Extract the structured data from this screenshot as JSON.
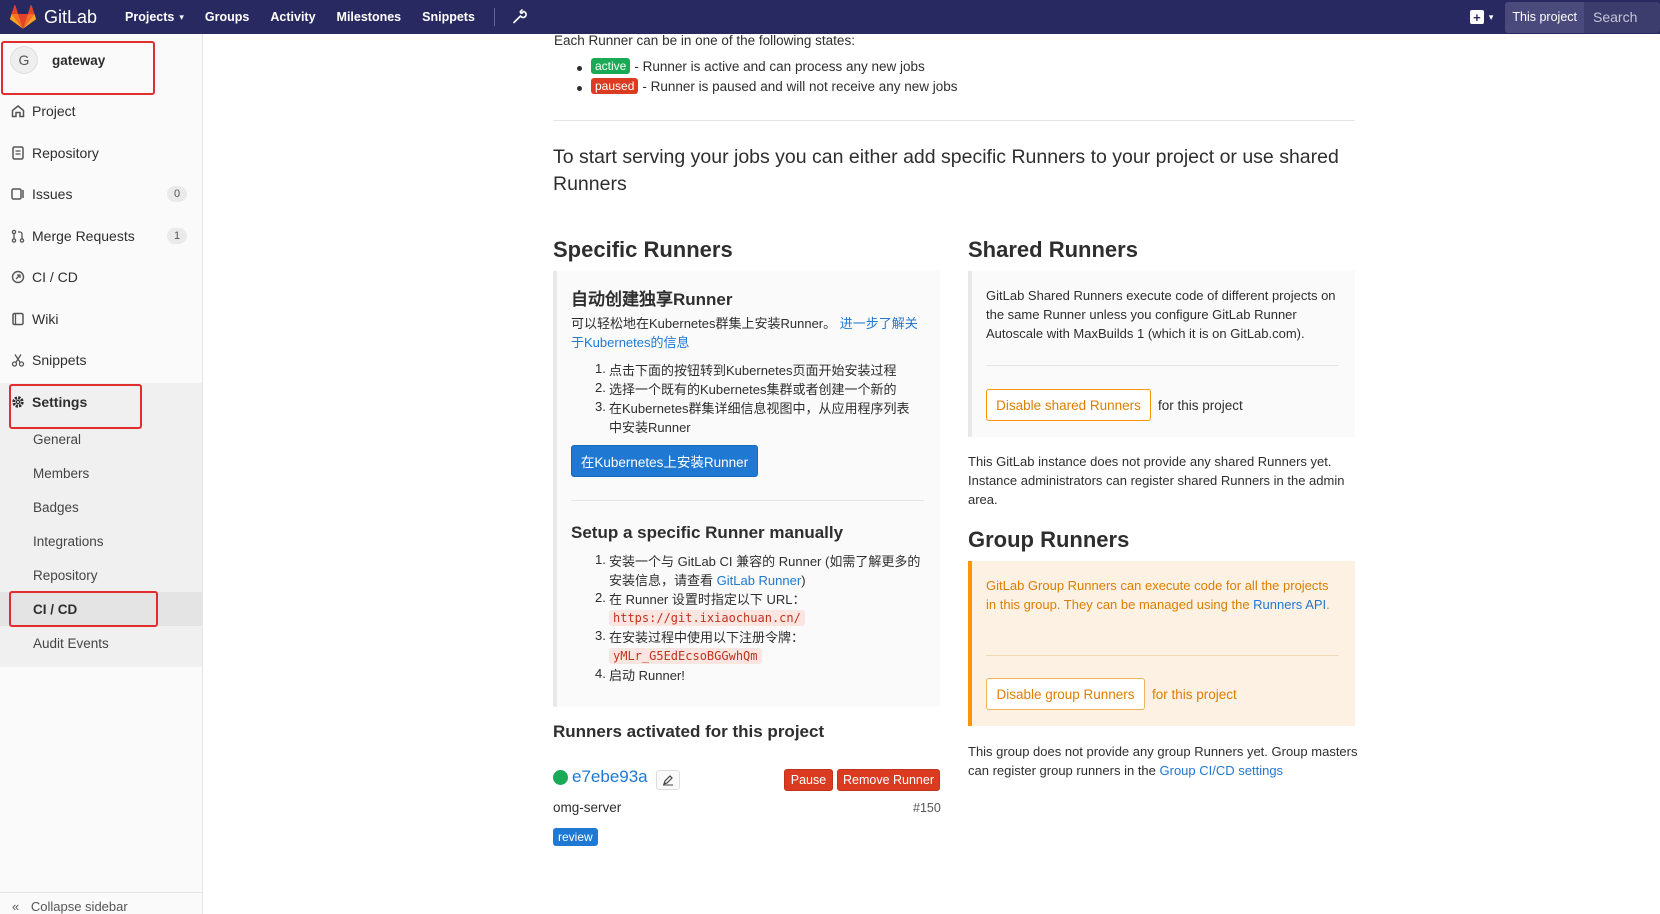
{
  "navbar": {
    "brand": "GitLab",
    "links": [
      "Projects",
      "Groups",
      "Activity",
      "Milestones",
      "Snippets"
    ],
    "scope_label": "This project",
    "search_placeholder": "Search"
  },
  "sidebar": {
    "project_initial": "G",
    "project_name": "gateway",
    "items": [
      {
        "label": "Project",
        "icon": "home-icon"
      },
      {
        "label": "Repository",
        "icon": "doc-icon"
      },
      {
        "label": "Issues",
        "icon": "issues-icon",
        "badge": "0"
      },
      {
        "label": "Merge Requests",
        "icon": "merge-icon",
        "badge": "1"
      },
      {
        "label": "CI / CD",
        "icon": "rocket-icon"
      },
      {
        "label": "Wiki",
        "icon": "book-icon"
      },
      {
        "label": "Snippets",
        "icon": "scissors-icon"
      },
      {
        "label": "Settings",
        "icon": "gear-icon"
      }
    ],
    "settings_sub": [
      "General",
      "Members",
      "Badges",
      "Integrations",
      "Repository",
      "CI / CD",
      "Audit Events"
    ],
    "collapse_label": "Collapse sidebar"
  },
  "states": {
    "intro": "Each Runner can be in one of the following states:",
    "active_label": "active",
    "active_desc": "- Runner is active and can process any new jobs",
    "paused_label": "paused",
    "paused_desc": "- Runner is paused and will not receive any new jobs"
  },
  "lead": "To start serving your jobs you can either add specific Runners to your project or use shared Runners",
  "specific": {
    "title": "Specific Runners",
    "k8s_title": "自动创建独享Runner",
    "k8s_desc": "可以轻松地在Kubernetes群集上安装Runner。",
    "k8s_link": "进一步了解关于Kubernetes的信息",
    "k8s_steps": [
      "点击下面的按钮转到Kubernetes页面开始安装过程",
      "选择一个既有的Kubernetes集群或者创建一个新的",
      "在Kubernetes群集详细信息视图中，从应用程序列表中安装Runner"
    ],
    "k8s_button": "在Kubernetes上安装Runner",
    "manual_title": "Setup a specific Runner manually",
    "manual_step1_a": "安装一个与 GitLab CI 兼容的 Runner (如需了解更多的安装信息，请查看 ",
    "manual_step1_link": "GitLab Runner",
    "manual_step1_b": ")",
    "manual_step2": "在 Runner 设置时指定以下 URL：",
    "url": "https://git.ixiaochuan.cn/",
    "manual_step3": "在安装过程中使用以下注册令牌：",
    "token": "yMLr_G5EdEcsoBGGwhQm",
    "manual_step4": "启动 Runner!"
  },
  "activated": {
    "title": "Runners activated for this project",
    "runner_id": "e7ebe93a",
    "pause_label": "Pause",
    "remove_label": "Remove Runner",
    "runner_name": "omg-server",
    "runner_number": "#150",
    "tag": "review"
  },
  "shared": {
    "title": "Shared Runners",
    "desc": "GitLab Shared Runners execute code of different projects on the same Runner unless you configure GitLab Runner Autoscale with MaxBuilds 1 (which it is on GitLab.com).",
    "button": "Disable shared Runners",
    "button_suffix": "for this project",
    "note": "This GitLab instance does not provide any shared Runners yet. Instance administrators can register shared Runners in the admin area."
  },
  "group": {
    "title": "Group Runners",
    "desc": "GitLab Group Runners can execute code for all the projects in this group. They can be managed using the ",
    "desc_link": "Runners API",
    "desc_end": ".",
    "button": "Disable group Runners",
    "button_suffix": "for this project",
    "note_a": "This group does not provide any group Runners yet. Group masters can register group runners in the ",
    "note_link": "Group CI/CD settings"
  },
  "colors": {
    "navbar": "#292961",
    "active": "#1aaa55",
    "paused": "#db3b21",
    "link": "#1f78d1",
    "warning": "#fc9403",
    "annotation": "#e12d2d"
  }
}
